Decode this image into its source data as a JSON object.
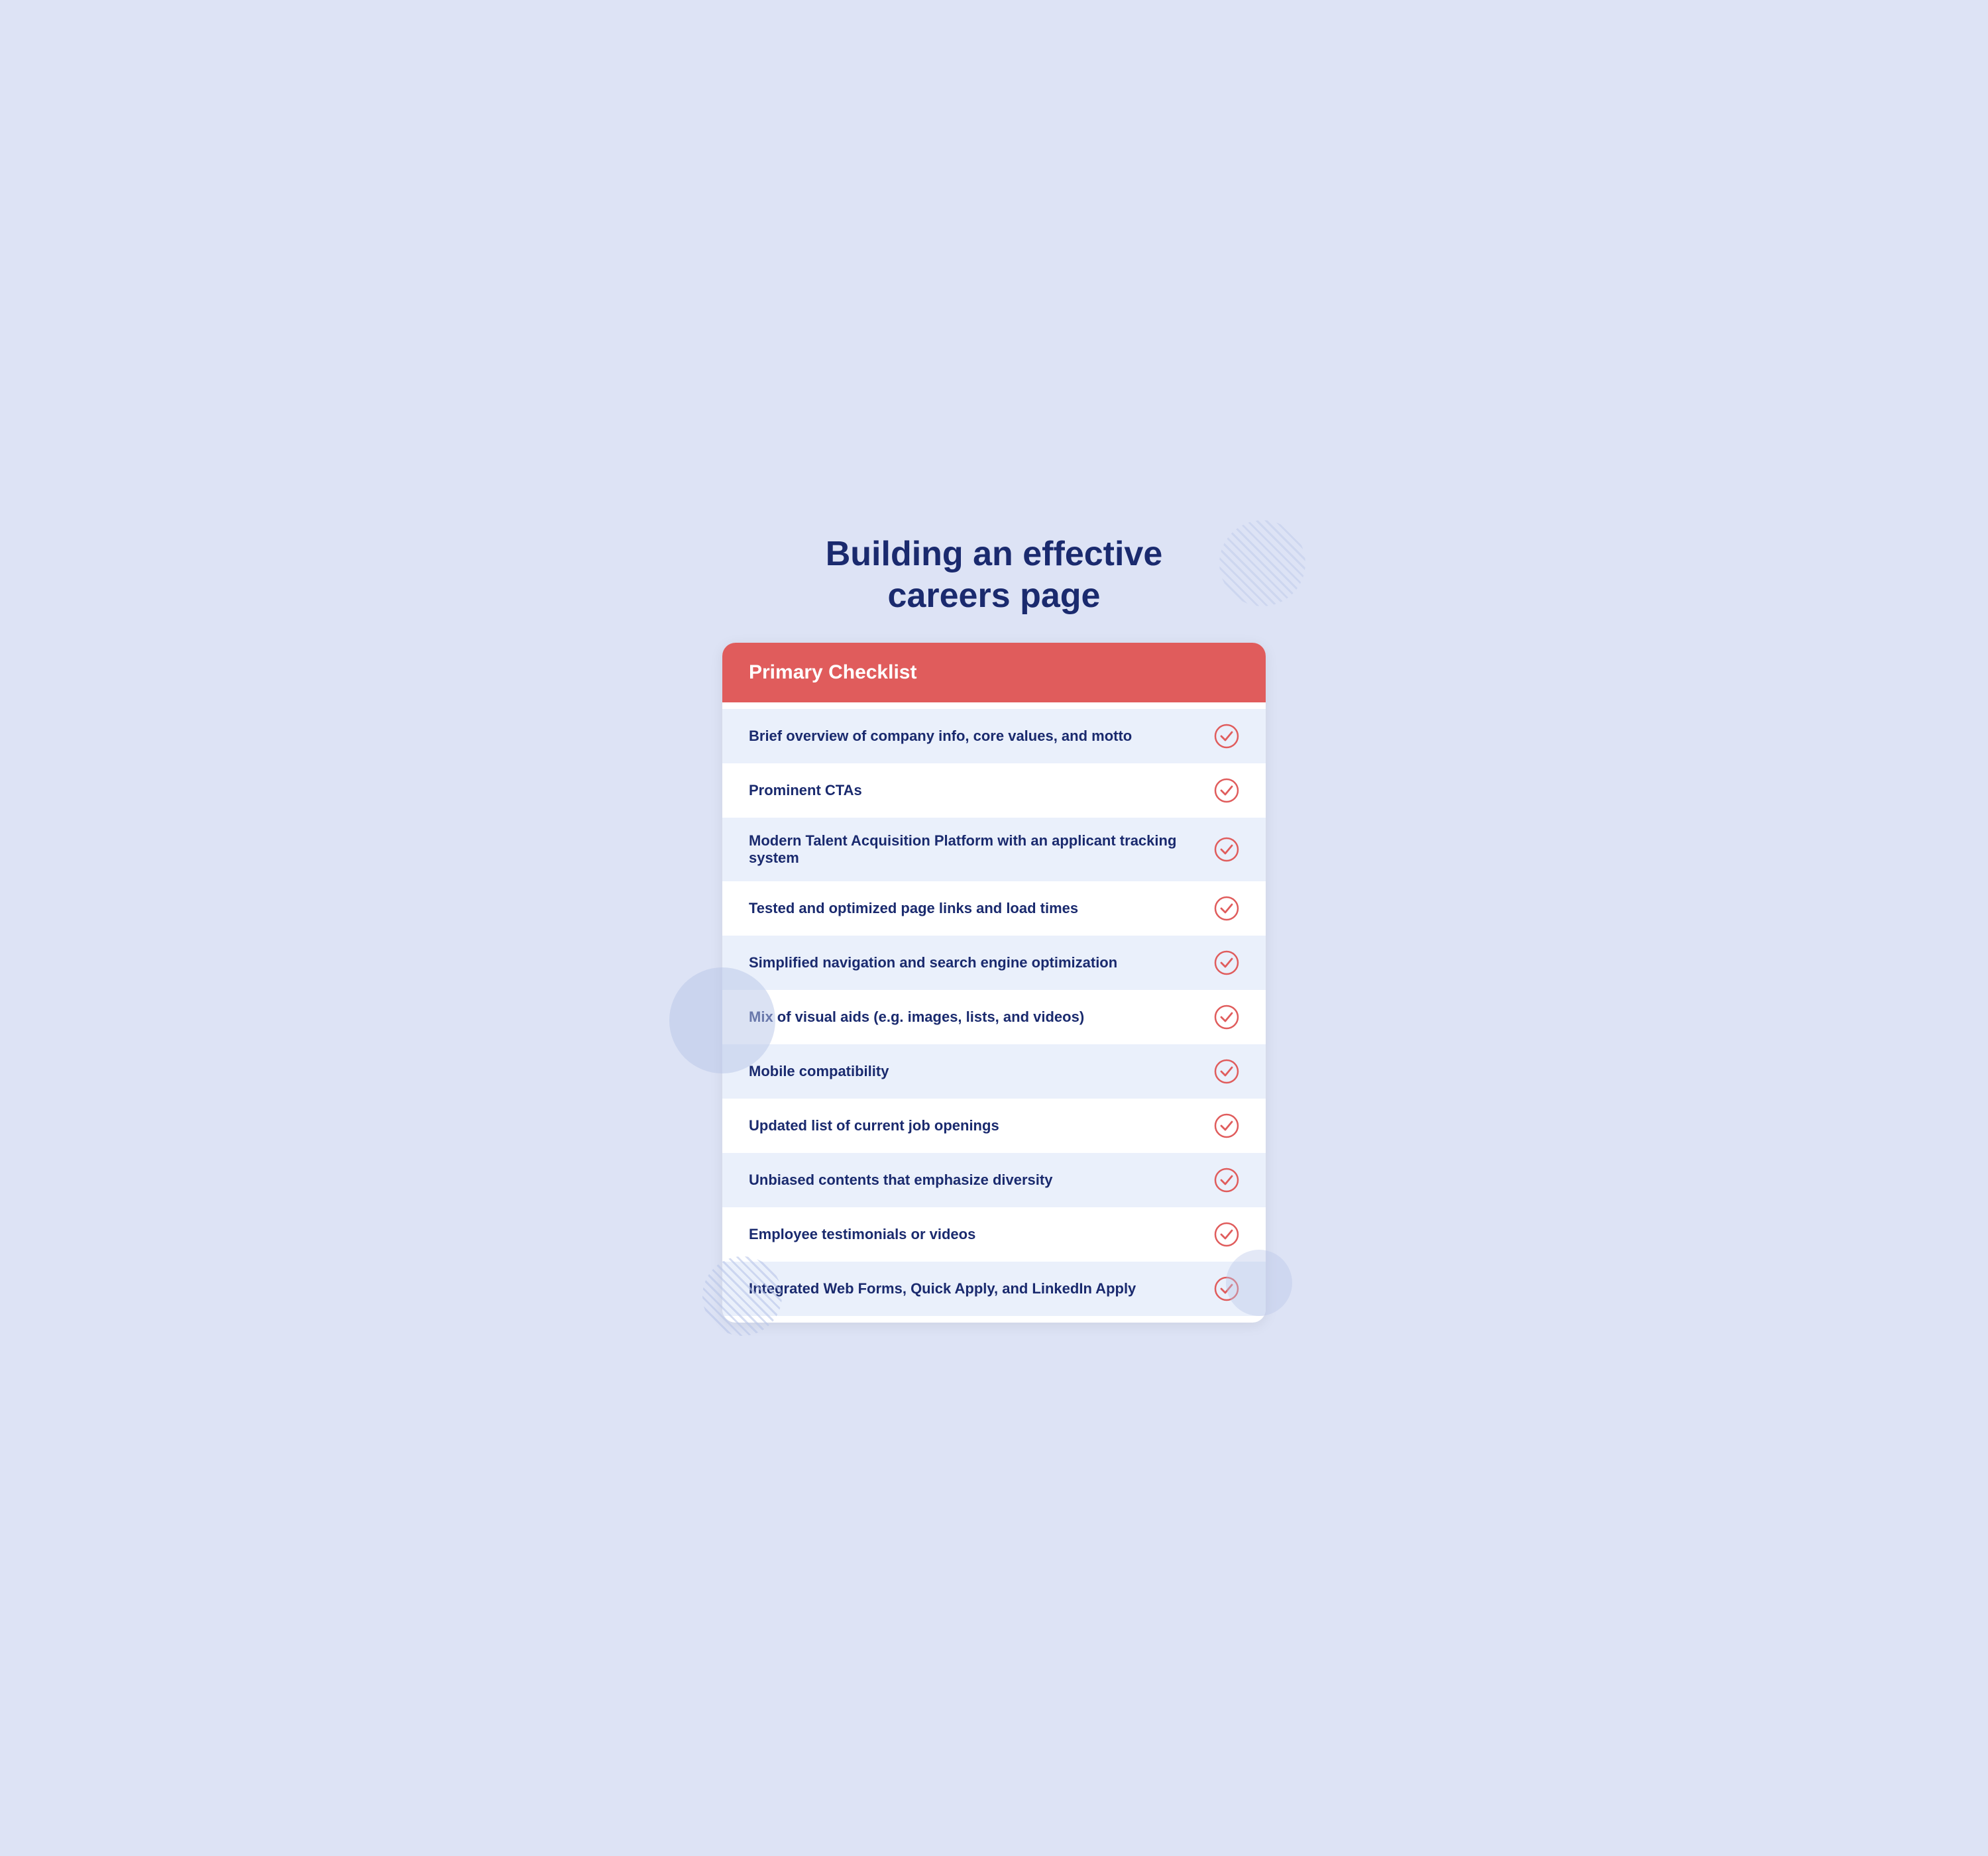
{
  "page": {
    "title_line1": "Building an effective",
    "title_line2": "careers page"
  },
  "checklist": {
    "header_label": "Primary Checklist",
    "items": [
      {
        "id": 1,
        "text": "Brief overview of company info, core values, and motto"
      },
      {
        "id": 2,
        "text": "Prominent CTAs"
      },
      {
        "id": 3,
        "text": "Modern Talent Acquisition Platform with an applicant tracking system"
      },
      {
        "id": 4,
        "text": "Tested and optimized page links and load times"
      },
      {
        "id": 5,
        "text": "Simplified navigation and search engine optimization"
      },
      {
        "id": 6,
        "text": "Mix of visual aids (e.g. images, lists, and videos)"
      },
      {
        "id": 7,
        "text": "Mobile compatibility"
      },
      {
        "id": 8,
        "text": "Updated list of current job openings"
      },
      {
        "id": 9,
        "text": "Unbiased contents that emphasize diversity"
      },
      {
        "id": 10,
        "text": "Employee testimonials or videos"
      },
      {
        "id": 11,
        "text": "Integrated Web Forms, Quick Apply, and LinkedIn Apply"
      }
    ]
  },
  "colors": {
    "title": "#1a2a6e",
    "header_bg": "#e05c5c",
    "check_color": "#e05c5c",
    "row_odd": "#eaf0fb",
    "row_even": "#ffffff"
  }
}
